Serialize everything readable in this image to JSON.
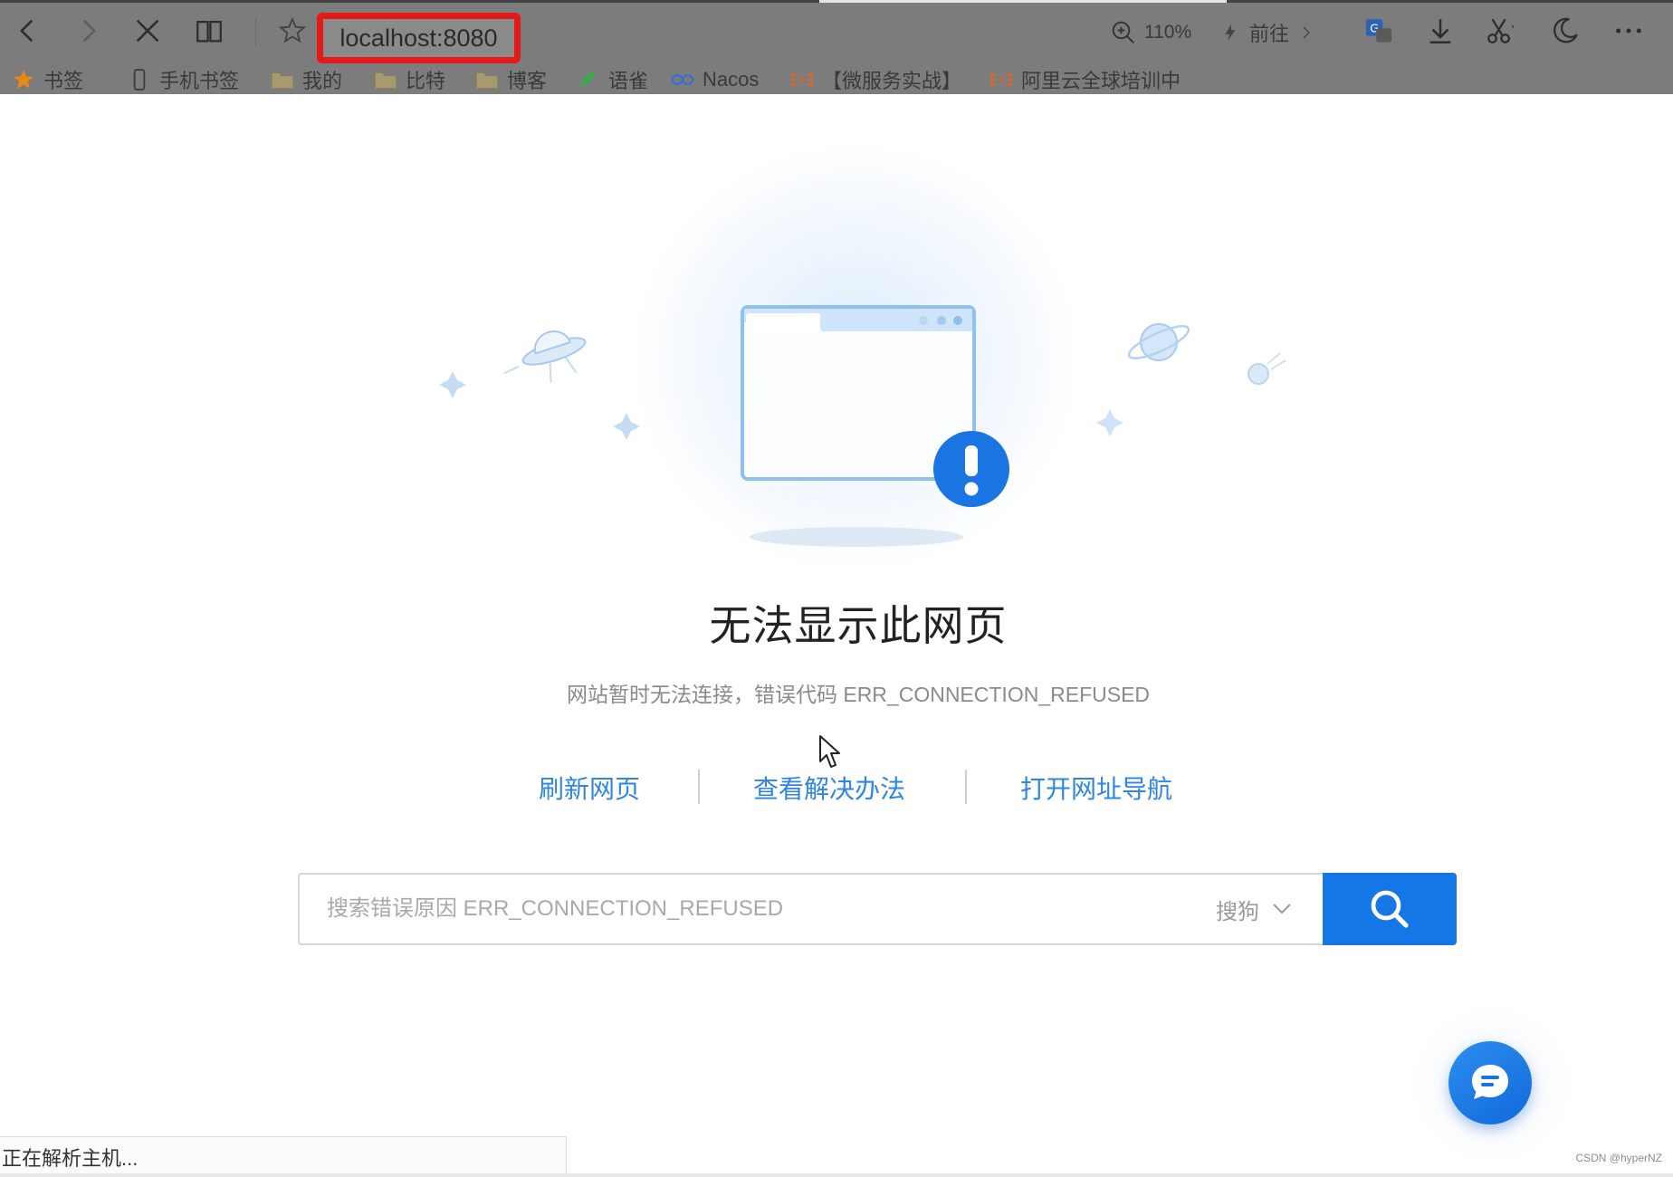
{
  "browser": {
    "address": "localhost:8080",
    "zoom_label": "110%",
    "goto_label": "前往",
    "bookmarks": [
      {
        "label": "书签",
        "icon": "star-icon"
      },
      {
        "label": "手机书签",
        "icon": "phone-icon"
      },
      {
        "label": "我的",
        "icon": "folder-icon"
      },
      {
        "label": "比特",
        "icon": "folder-icon"
      },
      {
        "label": "博客",
        "icon": "folder-icon"
      },
      {
        "label": "语雀",
        "icon": "yuque-icon"
      },
      {
        "label": "Nacos",
        "icon": "nacos-icon"
      },
      {
        "label": "【微服务实战】",
        "icon": "aliyun-icon"
      },
      {
        "label": "阿里云全球培训中",
        "icon": "aliyun-icon"
      }
    ]
  },
  "error_page": {
    "title": "无法显示此网页",
    "subtitle": "网站暂时无法连接，错误代码 ERR_CONNECTION_REFUSED",
    "actions": {
      "refresh": "刷新网页",
      "solutions": "查看解决办法",
      "nav": "打开网址导航"
    },
    "search": {
      "placeholder": "搜索错误原因 ERR_CONNECTION_REFUSED",
      "engine": "搜狗"
    }
  },
  "status_bar": {
    "text": "正在解析主机..."
  },
  "watermark": "CSDN @hyperNZ",
  "colors": {
    "accent": "#1576e5",
    "link": "#2f86e0",
    "highlight_box": "#e41a1a",
    "toolbar": "#7c7c7c"
  }
}
